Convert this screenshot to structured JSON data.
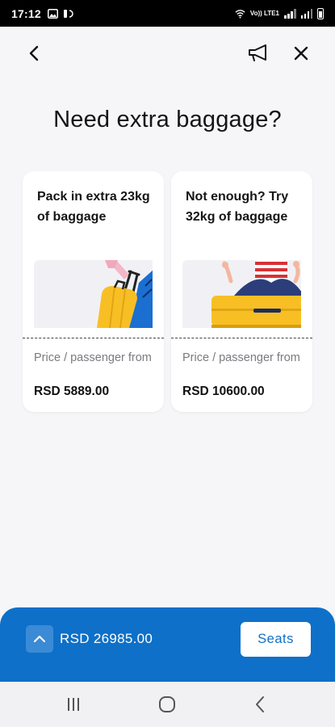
{
  "status_bar": {
    "time": "17:12",
    "network_label": "Vo)) LTE1"
  },
  "header": {
    "back_icon": "chevron-left-icon",
    "promo_icon": "megaphone-icon",
    "close_icon": "close-icon"
  },
  "page": {
    "title": "Need extra baggage?"
  },
  "options": [
    {
      "title": "Pack in extra 23kg of baggage",
      "price_label": "Price / passenger from",
      "price": "RSD 5889.00"
    },
    {
      "title": "Not enough? Try 32kg of baggage",
      "price_label": "Price / passenger from",
      "price": "RSD 10600.00"
    }
  ],
  "footer": {
    "total": "RSD 26985.00",
    "next_button": "Seats"
  },
  "colors": {
    "brand_blue": "#0e70c8",
    "suitcase_yellow": "#f8bf25",
    "background": "#f6f6f9"
  }
}
